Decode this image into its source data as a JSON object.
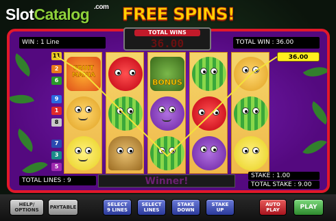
{
  "watermark": {
    "brand_part1": "Slot",
    "brand_part2": "Catalog",
    "suffix": ".com"
  },
  "title": "FREE SPINS!",
  "header": {
    "win_line": "WIN : 1 Line",
    "total_wins_label": "TOTAL WINS",
    "total_wins_value": "36.00",
    "total_win": "TOTAL WIN : 36.00"
  },
  "line_numbers": [
    "11",
    "2",
    "6",
    "9",
    "1",
    "8",
    "7",
    "3",
    "5"
  ],
  "win_amount": "36.00",
  "symbols": {
    "fruit_mania_line1": "FRUIT",
    "fruit_mania_line2": "MANIA",
    "bonus": "BONUS"
  },
  "footer": {
    "total_lines": "TOTAL LINES : 9",
    "message": "Winner!",
    "stake": "STAKE : 1.00",
    "total_stake": "TOTAL STAKE : 9.00"
  },
  "buttons": {
    "help": "HELP/ OPTIONS",
    "paytable": "PAYTABLE",
    "select9": "SELECT 9 LINES",
    "select_lines": "SELECT LINES",
    "stake_down": "STAKE DOWN",
    "stake_up": "STAKE UP",
    "auto_play": "AUTO PLAY",
    "play": "PLAY"
  },
  "colors": {
    "frame": "#e2182a",
    "background": "#5a0d92",
    "accent": "#ffd200",
    "play": "#2e8a2e"
  }
}
